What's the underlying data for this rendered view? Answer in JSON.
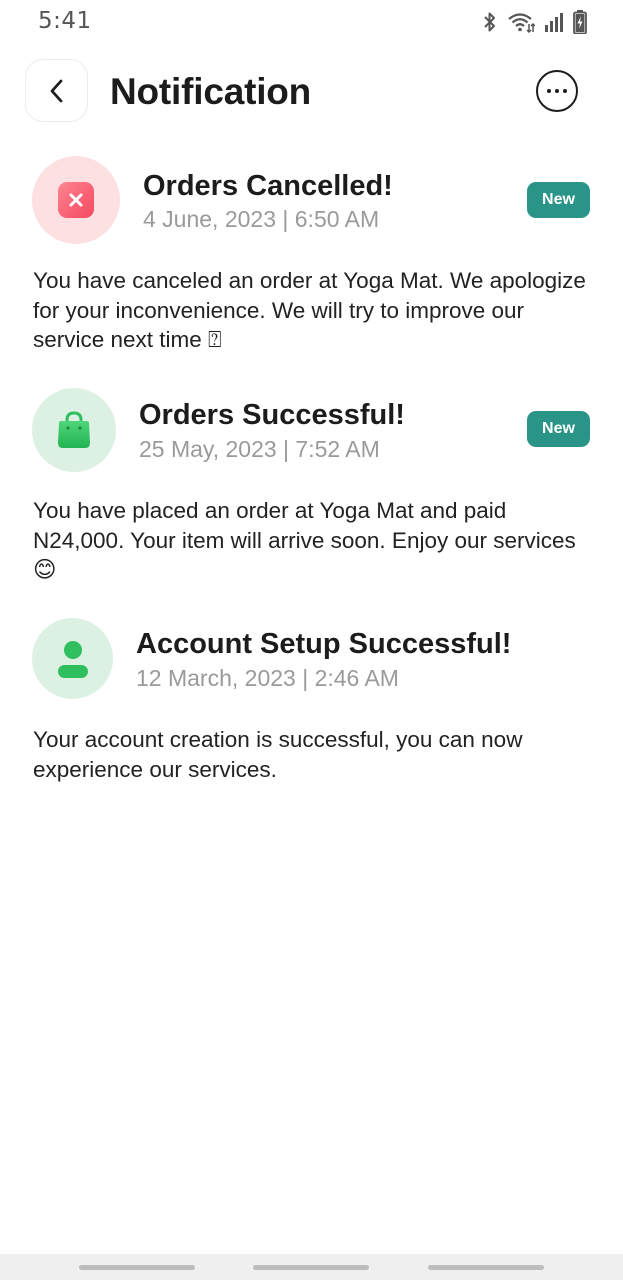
{
  "status_bar": {
    "time": "5:41",
    "icons": [
      "bluetooth-icon",
      "wifi-icon",
      "signal-icon",
      "battery-charging-icon"
    ]
  },
  "header": {
    "title": "Notification",
    "back_icon": "chevron-left-icon",
    "more_icon": "more-horizontal-icon"
  },
  "notifications": [
    {
      "title": "Orders Cancelled!",
      "date": "4 June, 2023 | 6:50 AM",
      "badge": "New",
      "icon": "cancel-icon",
      "icon_color": "#f4596d",
      "icon_bg": "#fde0e2",
      "message": "You have canceled an order at Yoga Mat. We apologize for your inconvenience. We will try to improve our service next time ⍰"
    },
    {
      "title": "Orders Successful!",
      "date": "25 May, 2023 | 7:52 AM",
      "badge": "New",
      "icon": "shopping-bag-icon",
      "icon_color": "#2fbf5e",
      "icon_bg": "#dcf1e3",
      "message": "You have placed an order at Yoga Mat and paid N24,000. Your item will arrive soon. Enjoy our services 😊"
    },
    {
      "title": "Account Setup Successful!",
      "date": "12 March, 2023 | 2:46 AM",
      "icon": "user-icon",
      "icon_color": "#2fbf5e",
      "icon_bg": "#dcf1e3",
      "message": "Your account creation is successful, you can now experience our services."
    }
  ],
  "colors": {
    "accent": "#2a9488",
    "title_text": "#1c1c1c",
    "date_text": "#9a9a9a"
  }
}
